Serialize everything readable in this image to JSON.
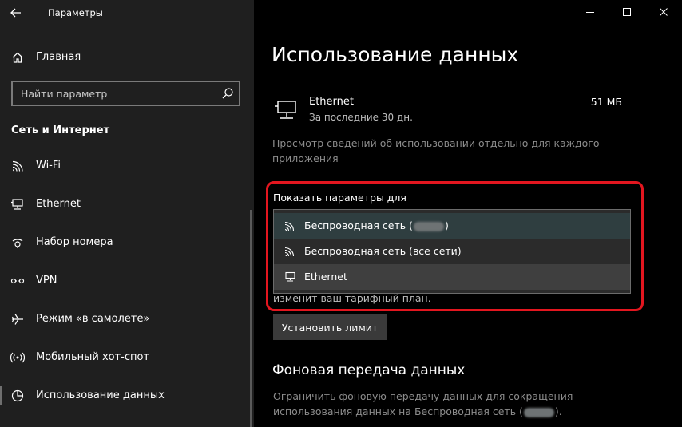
{
  "app": {
    "title": "Параметры"
  },
  "nav": {
    "home_label": "Главная",
    "search_placeholder": "Найти параметр",
    "section_title": "Сеть и Интернет",
    "items": [
      {
        "label": "Wi-Fi",
        "icon": "wifi-icon"
      },
      {
        "label": "Ethernet",
        "icon": "ethernet-icon"
      },
      {
        "label": "Набор номера",
        "icon": "dialup-icon"
      },
      {
        "label": "VPN",
        "icon": "vpn-icon"
      },
      {
        "label": "Режим «в самолете»",
        "icon": "airplane-icon"
      },
      {
        "label": "Мобильный хот-спот",
        "icon": "hotspot-icon"
      },
      {
        "label": "Использование данных",
        "icon": "data-usage-icon",
        "selected": true
      }
    ]
  },
  "main": {
    "title": "Использование данных",
    "ethernet": {
      "name": "Ethernet",
      "period": "За последние 30 дн.",
      "size": "51 МБ"
    },
    "details_link": "Просмотр сведений об использовании отдельно для каждого приложения",
    "show_settings_label": "Показать параметры для",
    "dropdown_options": [
      {
        "label": "Беспроводная сеть (",
        "suffix": ")",
        "icon": "wifi-icon"
      },
      {
        "label": "Беспроводная сеть (все сети)",
        "icon": "wifi-icon"
      },
      {
        "label": "Ethernet",
        "icon": "ethernet-icon"
      }
    ],
    "plan_text": "изменит ваш тарифный план.",
    "set_limit_button": "Установить лимит",
    "background_title": "Фоновая передача данных",
    "background_text_1": "Ограничить фоновую передачу данных для сокращения использования данных на Беспроводная сеть (",
    "background_text_2": ")."
  },
  "colors": {
    "nav_bg": "#1f1f1f",
    "content_bg": "#000000",
    "highlight": "#e3161f",
    "selected_option": "#2f3e40"
  }
}
